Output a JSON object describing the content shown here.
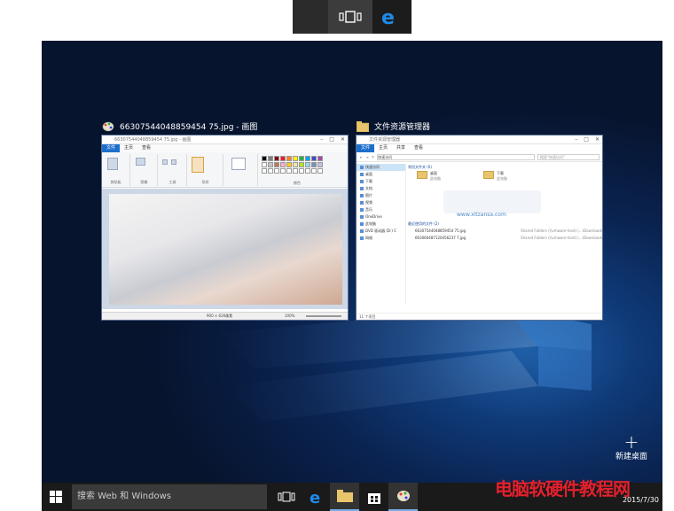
{
  "top_bar": {
    "icons": [
      "task-view-icon",
      "edge-icon"
    ]
  },
  "windows": {
    "paint": {
      "title": "66307544048859454 75.jpg - 画图",
      "inner_title": "66307544048859454 75.jpg - 画图",
      "tabs": [
        "文件",
        "主页",
        "查看"
      ],
      "groups": [
        "剪贴板",
        "图像",
        "工具",
        "形状",
        "颜色"
      ],
      "status": "900 × 626像素",
      "zoom": "100%"
    },
    "explorer": {
      "title": "文件资源管理器",
      "inner_title": "文件资源管理器",
      "tabs": [
        "文件",
        "主页",
        "共享",
        "查看"
      ],
      "address": "快速访问",
      "search_placeholder": "搜索\"快速访问\"",
      "nav_items": [
        "快速访问",
        "桌面",
        "下载",
        "文档",
        "图片",
        "视频",
        "音乐",
        "OneDrive",
        "此电脑",
        "DVD 驱动器 (D:) C",
        "网络"
      ],
      "sections": {
        "frequent": "常用文件夹 (6)",
        "recent": "最近使用的文件 (2)"
      },
      "folders": [
        {
          "name": "桌面",
          "sub": "此电脑"
        },
        {
          "name": "下载",
          "sub": "此电脑"
        }
      ],
      "recent_files": [
        {
          "name": "66307544048859454 75.jpg",
          "path": "Shared Folders (\\\\vmware-host) (...\\Downloads"
        },
        {
          "name": "663066487120456237 7.jpg",
          "path": "Shared Folders (\\\\vmware-host) (...\\Downloads"
        }
      ],
      "status": "11 个项目",
      "watermark_site": "www.xitzansa.com"
    }
  },
  "new_desktop": {
    "label": "新建桌面"
  },
  "taskbar": {
    "search_placeholder": "搜索 Web 和 Windows",
    "apps": [
      "task-view-icon",
      "edge-icon",
      "file-explorer-icon",
      "store-icon",
      "paint-icon"
    ],
    "tray_date": "2015/7/30"
  },
  "watermark": "电脑软硬件教程网",
  "colors": {
    "accent": "#1e6fcc",
    "taskbar": "#1a1a1a",
    "watermark": "#e3202d"
  }
}
